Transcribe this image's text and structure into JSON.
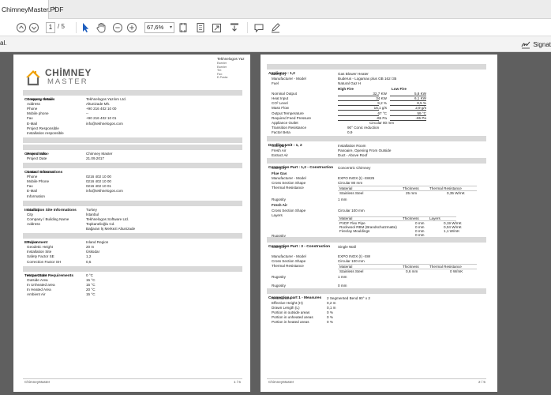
{
  "window": {
    "tab_title": "ChimneyMaster.PDF",
    "tab_close": "×"
  },
  "toolbar": {
    "page_current": "1",
    "page_total": "/ 5",
    "zoom": "67,6%",
    "zoom_arrow": "▾"
  },
  "secbar": {
    "left": "al.",
    "sign_label": "Signat"
  },
  "page1": {
    "header_right": {
      "line1": "Tekhnelogos Yaz",
      "line2": "Esenler",
      "line3": "Esenler",
      "line4": "Tel:",
      "line5": "Fax:",
      "line6": "E-Posta:"
    },
    "logo_top": "CHİMNEY",
    "logo_bottom": "MASTER",
    "sections": [
      {
        "title": "Company details",
        "rows": [
          [
            "Company Name",
            "Tekhnelogos Yazılım Ltd."
          ],
          [
            "Address",
            "Altunizade Mh."
          ],
          [
            "Phone",
            "+90 216 402 10 00"
          ],
          [
            "Mobile phone",
            "--"
          ],
          [
            "Fax",
            "+90 216 402 10 01"
          ],
          [
            "E-Mail",
            "info@tekhnelogos.com"
          ],
          [
            "Project Responsible",
            ""
          ],
          [
            "Installation responsible",
            ""
          ]
        ]
      },
      {
        "title": "Project Details",
        "rows": []
      },
      {
        "title": "General Info",
        "rows": [
          [
            "Project Name",
            "Chimney Master"
          ],
          [
            "Project Date",
            "21.09.2017"
          ]
        ]
      },
      {
        "title": "Contact Informations",
        "rows": [
          [
            "Name / Surname",
            ""
          ],
          [
            "Phone",
            "0216 402 10 00"
          ],
          [
            "Mobile Phone",
            "0216 402 10 00"
          ],
          [
            "Fax",
            "0216 402 10 01"
          ],
          [
            "E-Mail",
            "info@tekhnelogos.com"
          ],
          [
            "Information",
            ""
          ]
        ]
      },
      {
        "title": "Installation Site Informations",
        "rows": [
          [
            "Country",
            "Turkey"
          ],
          [
            "City",
            "İstanbul"
          ],
          [
            "Company / Building Name",
            "Tekhnelogos Software Ltd."
          ],
          [
            "Address",
            "Topkanelioğlu Cd."
          ],
          [
            "",
            "Bağaran İş Merkezi Altunizade"
          ]
        ]
      },
      {
        "title": "Environment",
        "rows": [
          [
            "Region",
            "Inland Region"
          ],
          [
            "Geodetic Height",
            "20 m"
          ],
          [
            "Installation Site",
            "Üsküdar"
          ],
          [
            "Safety Factor SE",
            "1,2"
          ],
          [
            "Correction Factor SH",
            "0,5"
          ]
        ]
      },
      {
        "title": "Temperature Requirements",
        "rows": [
          [
            "At top Outlet",
            "0 °C"
          ],
          [
            "Outside Area",
            "15 °C"
          ],
          [
            "In Unheated area",
            "15 °C"
          ],
          [
            "In Heated Area",
            "20 °C"
          ],
          [
            "Ambient Air",
            "15 °C"
          ]
        ]
      }
    ],
    "footer_left": "ChimneyMaster",
    "footer_right": "1 / 5"
  },
  "page2": {
    "appliance_title": "Appliance : 1,2",
    "appliance_rows": [
      [
        "Category",
        "Gas Blower Heater"
      ],
      [
        "Manufacturer - Model",
        "Buderus - Logamax plus GB 162 /35"
      ],
      [
        "Fuel",
        "Natural Gaz H"
      ]
    ],
    "fire_headers": [
      "High Fire",
      "Low Fire"
    ],
    "fire_rows": [
      [
        "Nominal Output",
        "32,7 KW",
        "5,8 KW"
      ],
      [
        "Heat Input",
        "34 KW",
        "6,1 KW"
      ],
      [
        "CO² Level",
        "9,2 %",
        "8,5 %"
      ],
      [
        "Mass Flow",
        "15,1 g/s",
        "2,9 g/s"
      ],
      [
        "Output Temperature",
        "67 °C",
        "59 °C"
      ],
      [
        "Required Feed Pressure",
        "-65 Pa",
        "-65 Pa"
      ]
    ],
    "appliance_outlet": [
      "Appliance Outlet",
      "Circular",
      "80 mm"
    ],
    "appliance_more": [
      [
        "Transition Resistance",
        "90° Conic reduction"
      ],
      [
        "Factor Beta",
        "0,9"
      ]
    ],
    "dwelling_title": "Dwelling Unit : 1, 2",
    "dwelling_rows": [
      [
        "Category",
        "Installation Room"
      ],
      [
        "Fresh Air",
        "Panoaire, Opening From Outside"
      ],
      [
        "Extract Air",
        "Duct - Above Roof"
      ]
    ],
    "conn1_title": "Connection Part : 1,2 - Construction",
    "conn1_category": [
      "Category",
      "Concentric Chimney"
    ],
    "flue_gas_label": "Flue Gas",
    "flue_rows": [
      [
        "Manufacturer - Model",
        "EXPO INOX (I) -SW25"
      ],
      [
        "Cross Section Shape",
        "Circular 80 mm"
      ],
      [
        "Thermal Resistance",
        ""
      ]
    ],
    "mat_headers": [
      "Material",
      "Thickness",
      "Thermal Resistance"
    ],
    "mat_row1": [
      "Stainless Steel",
      "25 mm",
      "0,35 W/mK"
    ],
    "rugosity": [
      "Rugosity",
      "1 mm"
    ],
    "fresh_air_label": "Fresh Air",
    "fresh_rows": [
      [
        "Cross Section Shape",
        "Circular 100 mm"
      ],
      [
        "Layers",
        ""
      ]
    ],
    "layer_headers": [
      "Material",
      "Thickness",
      "Layers"
    ],
    "layer_rows": [
      [
        "PVDF Flex Pipe",
        "0 mm",
        "0,19 W/mK"
      ],
      [
        "Rockwool RBM (Brandschutzmatte)",
        "0 mm",
        "0,04 W/mK"
      ],
      [
        "Fireclay Mouldings",
        "0 mm",
        "1,1 W/mK"
      ],
      [
        "",
        "0 mm",
        ""
      ]
    ],
    "rugosity2": "Rugosity",
    "conn2_title": "Connection Part : 3 - Construction",
    "conn2_rows": [
      [
        "Category",
        "Single Wall"
      ],
      [
        "Manufacturer - Model",
        "EXPO INOX (I) -SW"
      ],
      [
        "Cross Section Shape",
        "Circular 100 mm"
      ],
      [
        "Thermal Resistance",
        ""
      ]
    ],
    "mat2_row": [
      "Stainless Steel",
      "0,6 mm",
      "0 W/mK"
    ],
    "rugosity3": [
      "Rugosity",
      "1 mm"
    ],
    "rugosity4": [
      "Rugosity",
      "0 mm"
    ],
    "measures_title": "Connection part 1 - Measures",
    "measures_rows": [
      [
        "Resistances",
        "2 Segmented Bend 90° x 2"
      ],
      [
        "Effective Height (H)",
        "0,2 m"
      ],
      [
        "Drawn Length (L)",
        "0,1 m"
      ],
      [
        "Portion in outside areas",
        "0 %"
      ],
      [
        "Portion in unheated areas",
        "0 %"
      ],
      [
        "Portion in heated areas",
        "0 %"
      ]
    ],
    "footer_left": "ChimneyMaster",
    "footer_right": "2 / 5"
  }
}
